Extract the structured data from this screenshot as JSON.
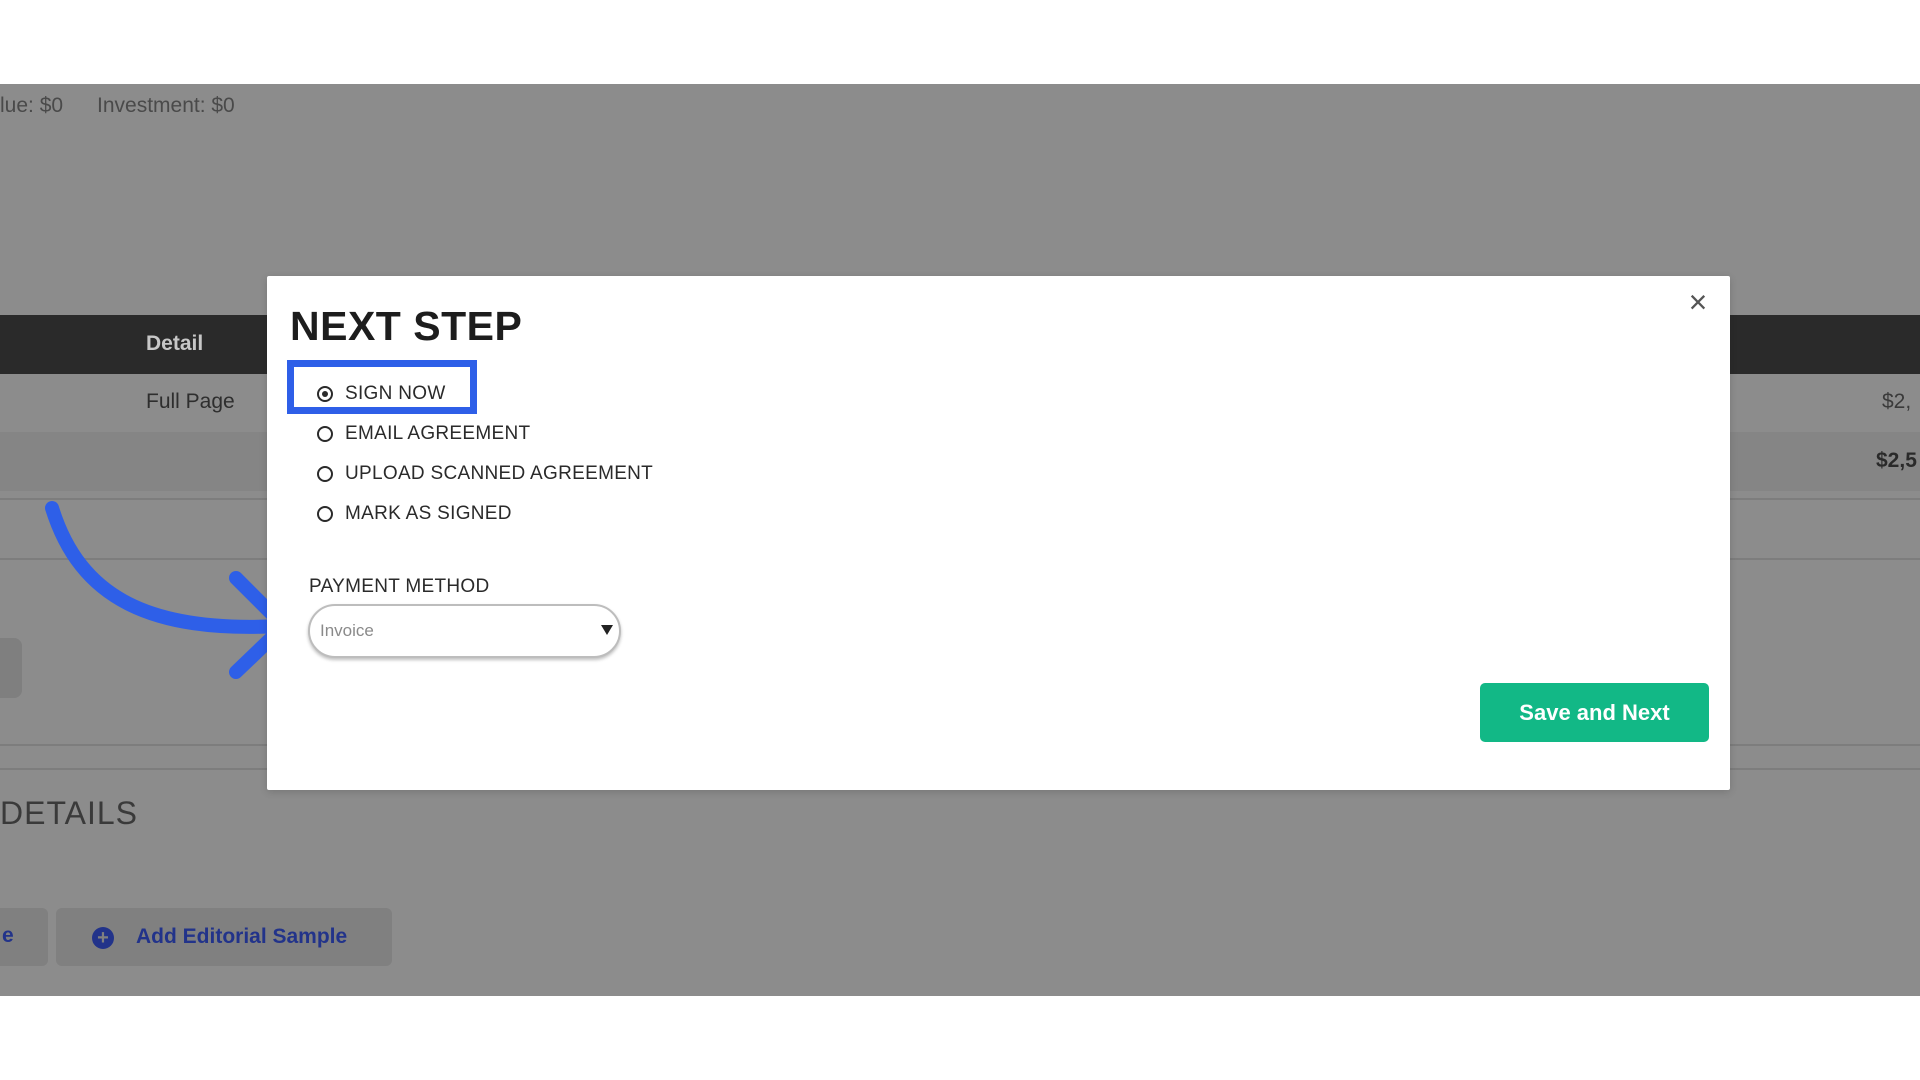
{
  "background": {
    "summary": {
      "value_label": "lue: $0",
      "investment_label": "Investment: $0"
    },
    "table": {
      "column_detail": "Detail",
      "row_detail": "Full Page",
      "row_amount": "$2,",
      "total_amount": "$2,5"
    },
    "section_heading": "DETAILS",
    "partial_button_label": "e",
    "add_editorial_label": "Add Editorial Sample"
  },
  "modal": {
    "title": "NEXT STEP",
    "close_icon": "close-icon",
    "options": [
      {
        "label": "SIGN NOW",
        "checked": true
      },
      {
        "label": "EMAIL AGREEMENT",
        "checked": false
      },
      {
        "label": "UPLOAD SCANNED AGREEMENT",
        "checked": false
      },
      {
        "label": "MARK AS SIGNED",
        "checked": false
      }
    ],
    "payment": {
      "label": "PAYMENT METHOD",
      "selected": "Invoice"
    },
    "save_button": "Save and Next"
  },
  "colors": {
    "overlay": "#8c8c8c",
    "accent_green": "#12b886",
    "annotation_blue": "#2e5fe8",
    "link_blue": "#22338a"
  }
}
